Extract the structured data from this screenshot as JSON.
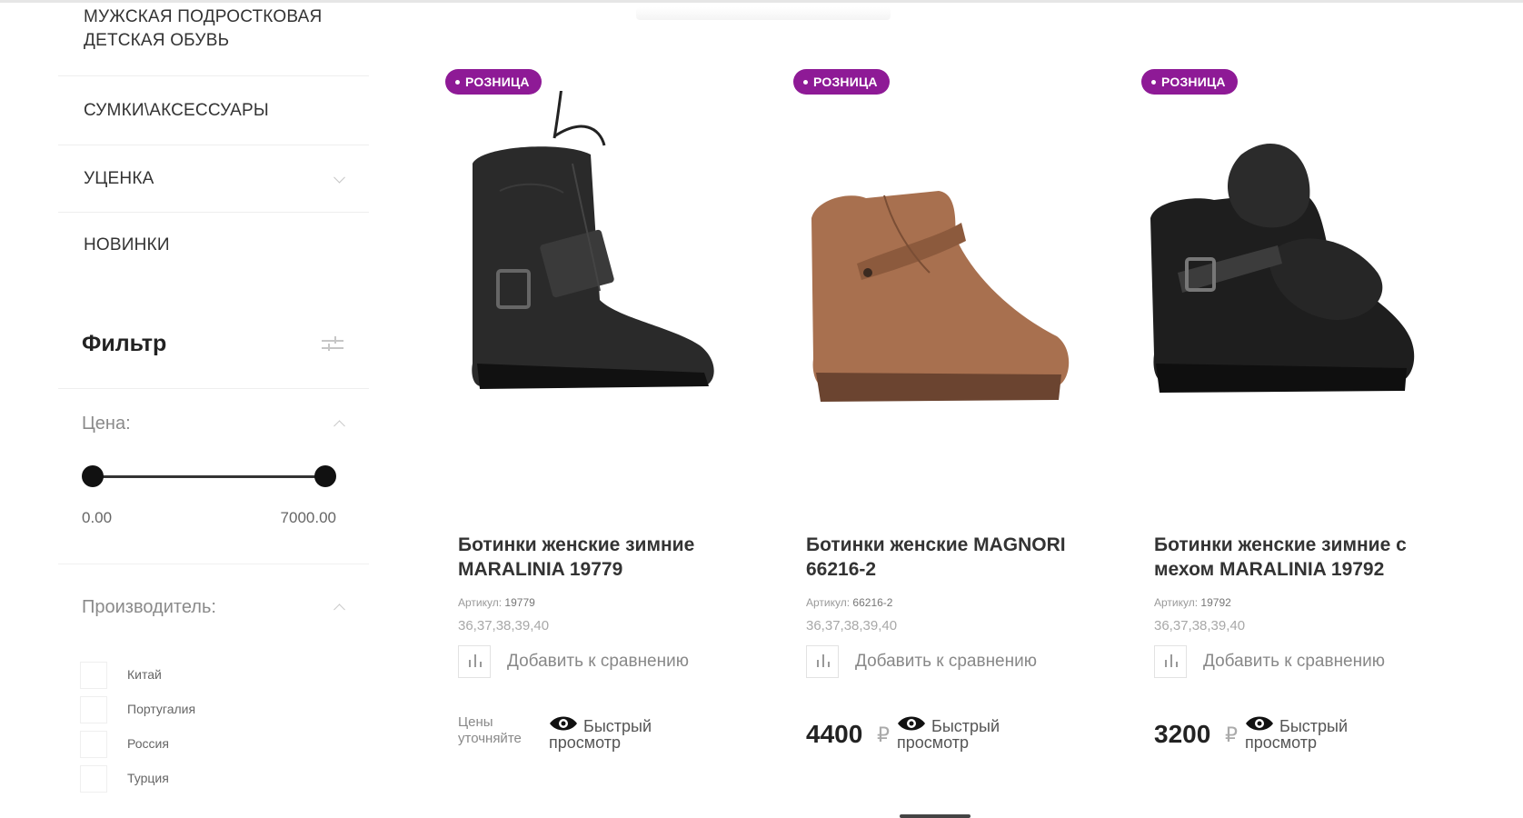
{
  "sidebar": {
    "categories": [
      {
        "label": "МУЖСКАЯ ПОДРОСТКОВАЯ ДЕТСКАЯ ОБУВЬ"
      },
      {
        "label": "СУМКИ\\АКСЕССУАРЫ"
      },
      {
        "label": "УЦЕНКА"
      },
      {
        "label": "НОВИНКИ"
      }
    ],
    "filter": {
      "title": "Фильтр",
      "price_label": "Цена:",
      "price_min": "0.00",
      "price_max": "7000.00",
      "price_range_selected": [
        0,
        1
      ],
      "maker_label": "Производитель:",
      "makers": [
        "Китай",
        "Португалия",
        "Россия",
        "Турция"
      ]
    }
  },
  "products": [
    {
      "badge": "РОЗНИЦА",
      "title": "Ботинки женские зимние MARALINIA 19779",
      "article_label": "Артикул:",
      "article": "19779",
      "sizes": "36,37,38,39,40",
      "compare_label": "Добавить к сравнению",
      "price_note": "Цены уточняйте",
      "price": "",
      "currency": "",
      "quick_view": "Быстрый просмотр"
    },
    {
      "badge": "РОЗНИЦА",
      "title": "Ботинки женские MAGNORI 66216-2",
      "article_label": "Артикул:",
      "article": "66216-2",
      "sizes": "36,37,38,39,40",
      "compare_label": "Добавить к сравнению",
      "price_note": "",
      "price": "4400",
      "currency": "₽",
      "quick_view": "Быстрый просмотр"
    },
    {
      "badge": "РОЗНИЦА",
      "title": "Ботинки женские зимние с мехом MARALINIA 19792",
      "article_label": "Артикул:",
      "article": "19792",
      "sizes": "36,37,38,39,40",
      "compare_label": "Добавить к сравнению",
      "price_note": "",
      "price": "3200",
      "currency": "₽",
      "quick_view": "Быстрый просмотр"
    }
  ],
  "colors": {
    "badge": "#8e1a96",
    "text_dark": "#222222",
    "text_muted": "#888888"
  }
}
